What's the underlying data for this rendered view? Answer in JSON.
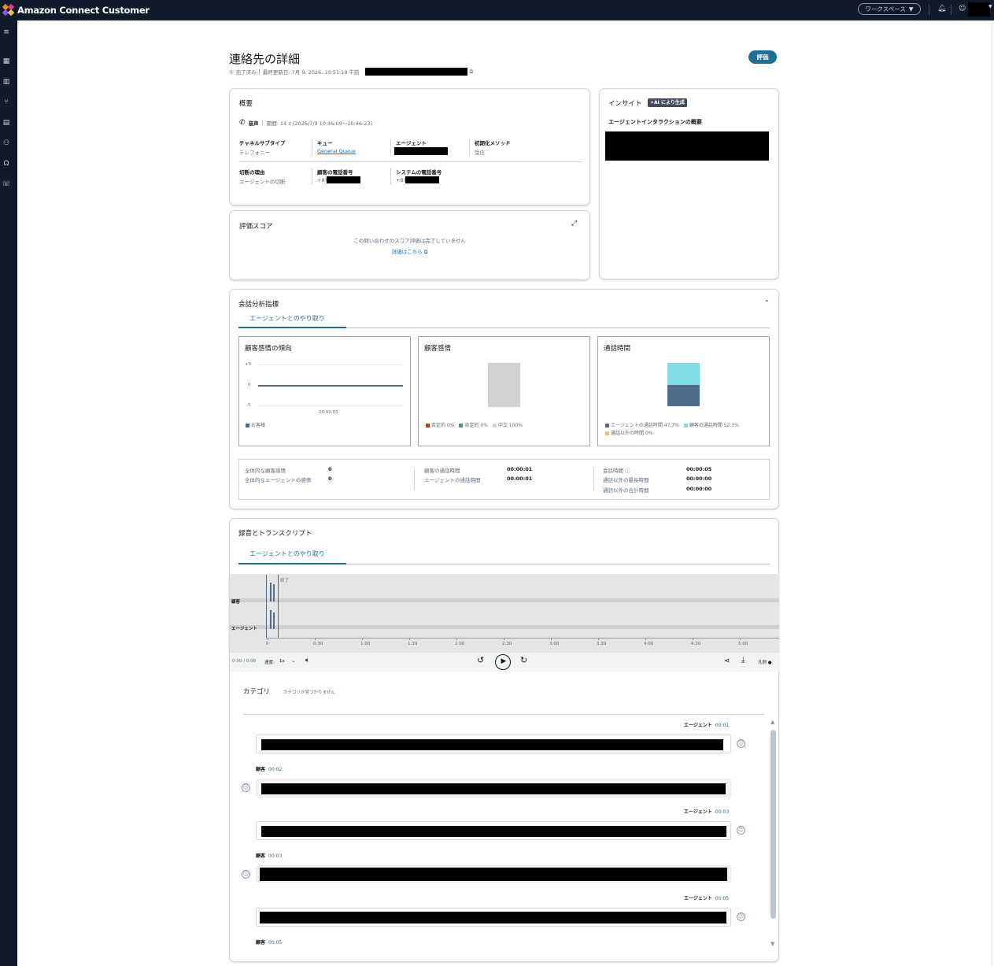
{
  "app": {
    "title": "Amazon Connect Customer",
    "workspace_label": "ワークスペース"
  },
  "page": {
    "title": "連絡先の詳細",
    "status": "完了済み",
    "last_updated": "最終更新日: 7月 9, 2026, 10:51:19 午前",
    "eval_button": "評価"
  },
  "summary": {
    "title": "概要",
    "channel": "音声",
    "duration": "期間: 14 s (2026/7/9 10:46:09～10:46:23)",
    "fields": [
      {
        "label": "チャネルサブタイプ",
        "value": "テレフォニー"
      },
      {
        "label": "キュー",
        "value": "General Queue"
      },
      {
        "label": "エージェント",
        "value": ""
      },
      {
        "label": "初期化メソッド",
        "value": "受信"
      },
      {
        "label": "切断の理由",
        "value": "エージェントの切断"
      },
      {
        "label": "顧客の電話番号",
        "value": "+81"
      },
      {
        "label": "システムの電話番号",
        "value": "+81"
      }
    ]
  },
  "eval_score": {
    "title": "評価スコア",
    "message": "この問い合わせのスコア評価は完了していません",
    "link": "詳細はこちら"
  },
  "insight": {
    "title": "インサイト",
    "badge": "AI により生成",
    "subtitle": "エージェントインタラクションの概要"
  },
  "analytics": {
    "title": "会話分析指標",
    "tab": "エージェントとのやり取り",
    "trend": {
      "title": "顧客感情の傾向",
      "yticks": [
        "+5",
        "0",
        "-5"
      ],
      "xtick": "00:00:05",
      "legend": "お客様"
    },
    "sentiment": {
      "title": "顧客感情",
      "legend": [
        "否定的 0%",
        "肯定的 0%",
        "中立 100%"
      ]
    },
    "talktime": {
      "title": "通話時間",
      "legend": [
        "エージェントの通話時間 47.7%",
        "顧客の通話時間 52.3%",
        "通話以外の時間 0%"
      ]
    },
    "stats": [
      {
        "label": "全体的な顧客感情",
        "value": "0"
      },
      {
        "label": "全体的なエージェントの感情",
        "value": "0"
      },
      {
        "label": "顧客の通話時間",
        "value": "00:00:01"
      },
      {
        "label": "エージェントの通話時間",
        "value": "00:00:01"
      },
      {
        "label": "会話時間",
        "value": "00:00:05"
      },
      {
        "label": "通話以外の最長時間",
        "value": "00:00:00"
      },
      {
        "label": "通話以外の合計時間",
        "value": "00:00:00"
      }
    ]
  },
  "recording": {
    "title": "録音とトランスクリプト",
    "tab": "エージェントとのやり取り",
    "end_label": "終了",
    "row_customer": "顧客",
    "row_agent": "エージェント",
    "ticks": [
      "0",
      "0:30",
      "1:00",
      "1:30",
      "2:00",
      "2:30",
      "3:00",
      "3:30",
      "4:00",
      "4:30",
      "5:00"
    ],
    "time": "0:00 / 0:08",
    "speed_label": "速度:",
    "speed": "1x",
    "legend_label": "凡例"
  },
  "category": {
    "title": "カテゴリ",
    "empty": "カテゴリが見つかりません"
  },
  "transcript": [
    {
      "speaker": "エージェント",
      "time": "00:01"
    },
    {
      "speaker": "顧客",
      "time": "00:02"
    },
    {
      "speaker": "エージェント",
      "time": "00:03"
    },
    {
      "speaker": "顧客",
      "time": "00:03"
    },
    {
      "speaker": "エージェント",
      "time": "00:05"
    },
    {
      "speaker": "顧客",
      "time": "00:05"
    }
  ],
  "colors": {
    "accent": "#1f6e93",
    "negative": "#d13212",
    "positive": "#41a061",
    "neutral": "#d1d1d1",
    "agent": "#516b8a",
    "customer": "#7fdce6"
  }
}
